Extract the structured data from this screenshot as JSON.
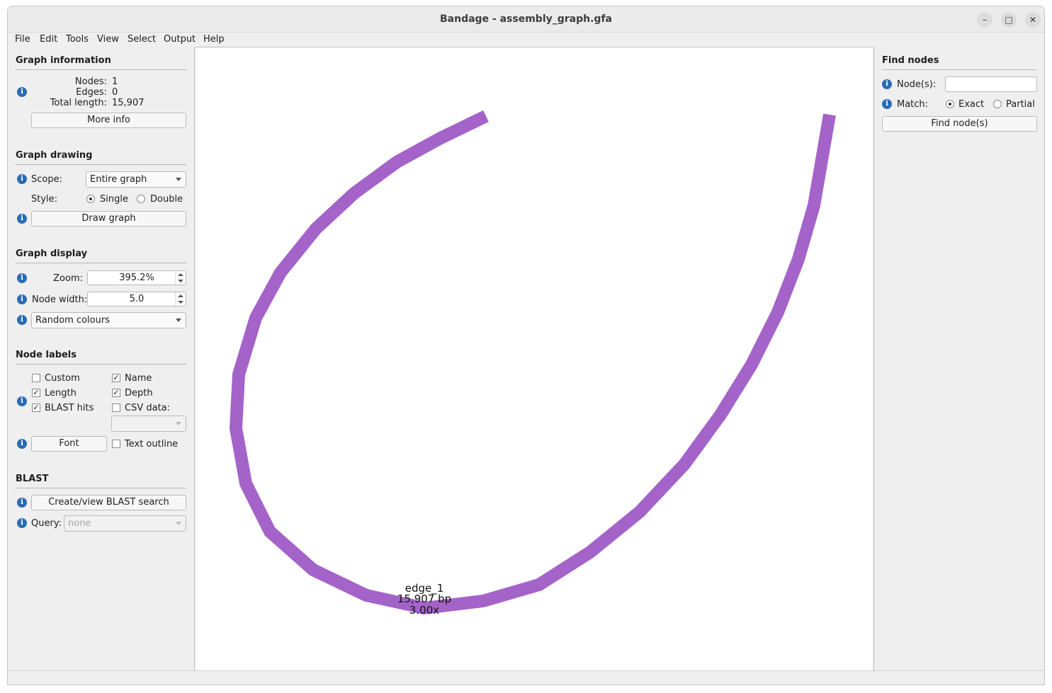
{
  "window": {
    "title": "Bandage - assembly_graph.gfa",
    "minimize_glyph": "–",
    "maximize_glyph": "□",
    "close_glyph": "✕"
  },
  "menu": [
    "File",
    "Edit",
    "Tools",
    "View",
    "Select",
    "Output",
    "Help"
  ],
  "graph_information": {
    "title": "Graph information",
    "nodes_label": "Nodes:",
    "nodes_value": "1",
    "edges_label": "Edges:",
    "edges_value": "0",
    "length_label": "Total length:",
    "length_value": "15,907",
    "more_info": "More info"
  },
  "graph_drawing": {
    "title": "Graph drawing",
    "scope_label": "Scope:",
    "scope_value": "Entire graph",
    "style_label": "Style:",
    "style_single": "Single",
    "style_double": "Double",
    "style_selected": "Single",
    "draw_graph": "Draw graph"
  },
  "graph_display": {
    "title": "Graph display",
    "zoom_label": "Zoom:",
    "zoom_value": "395.2%",
    "node_width_label": "Node width:",
    "node_width_value": "5.0",
    "colour_scheme": "Random colours"
  },
  "node_labels": {
    "title": "Node labels",
    "custom": "Custom",
    "custom_checked": false,
    "name": "Name",
    "name_checked": true,
    "length": "Length",
    "length_checked": true,
    "depth": "Depth",
    "depth_checked": true,
    "blast_hits": "BLAST hits",
    "blast_hits_checked": true,
    "csv_data": "CSV data:",
    "csv_data_checked": false,
    "font": "Font",
    "text_outline": "Text outline",
    "text_outline_checked": false
  },
  "blast": {
    "title": "BLAST",
    "create_view": "Create/view BLAST search",
    "query_label": "Query:",
    "query_value": "none"
  },
  "find_nodes": {
    "title": "Find nodes",
    "nodes_label": "Node(s):",
    "nodes_value": "",
    "match_label": "Match:",
    "match_exact": "Exact",
    "match_partial": "Partial",
    "match_selected": "Exact",
    "find_button": "Find node(s)"
  },
  "graph": {
    "node_color": "#a463c9",
    "node_name": "edge_1",
    "node_length": "15,907 bp",
    "node_depth": "3.00x"
  },
  "icons": {
    "info": "i",
    "check": "✓"
  }
}
